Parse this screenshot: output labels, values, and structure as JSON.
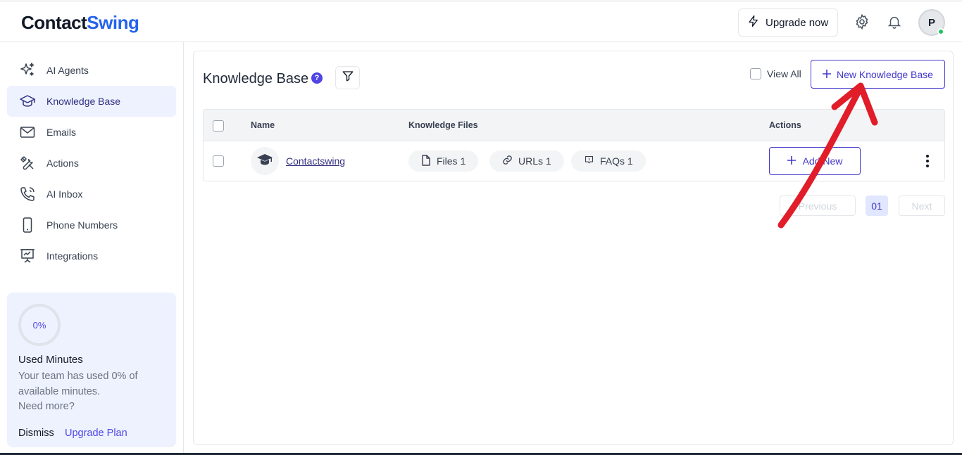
{
  "header": {
    "logo_prefix": "Contact",
    "logo_suffix": "Swing",
    "upgrade_label": "Upgrade now",
    "avatar_initial": "P"
  },
  "sidebar": {
    "items": [
      {
        "label": "AI Agents",
        "icon": "sparkles-icon"
      },
      {
        "label": "Knowledge Base",
        "icon": "graduation-cap-icon",
        "active": true
      },
      {
        "label": "Emails",
        "icon": "mail-icon"
      },
      {
        "label": "Actions",
        "icon": "tools-icon"
      },
      {
        "label": "AI Inbox",
        "icon": "phone-call-icon"
      },
      {
        "label": "Phone Numbers",
        "icon": "smartphone-icon"
      },
      {
        "label": "Integrations",
        "icon": "presentation-icon"
      }
    ],
    "usage": {
      "percent_label": "0%",
      "title": "Used Minutes",
      "description": "Your team has used 0% of available minutes.",
      "need_more": "Need more?",
      "dismiss_label": "Dismiss",
      "upgrade_label": "Upgrade Plan"
    }
  },
  "main": {
    "title": "Knowledge Base",
    "help_glyph": "?",
    "view_all_label": "View All",
    "new_button_label": "New Knowledge Base",
    "table": {
      "columns": [
        "Name",
        "Knowledge Files",
        "Actions"
      ],
      "rows": [
        {
          "name": "Contactswing",
          "files_label": "Files 1",
          "urls_label": "URLs 1",
          "faqs_label": "FAQs 1",
          "action_label": "Add New"
        }
      ]
    },
    "pagination": {
      "previous_label": "Previous",
      "current_page": "01",
      "next_label": "Next"
    }
  },
  "colors": {
    "accent": "#4338ca",
    "active_bg": "#eef2ff",
    "annotation_arrow": "#e11d2a",
    "online_status": "#22c55e"
  }
}
